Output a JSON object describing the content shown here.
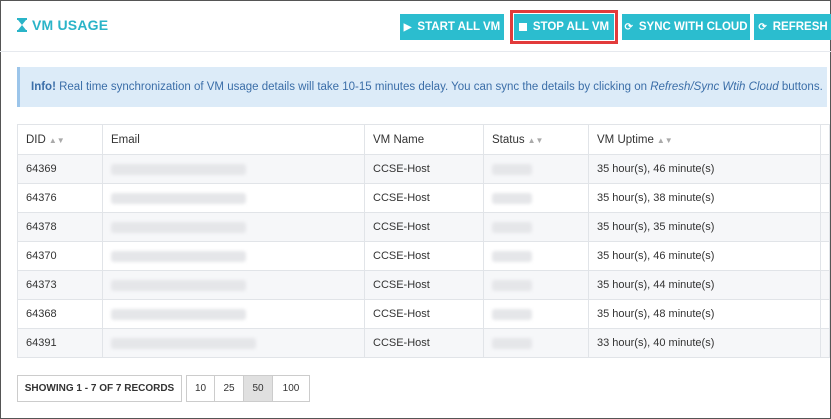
{
  "header": {
    "title": "VM USAGE",
    "title_icon": "hourglass-icon",
    "buttons": {
      "start_all": "START ALL VM",
      "stop_all": "STOP ALL VM",
      "sync_cloud": "SYNC WITH CLOUD",
      "refresh": "REFRESH"
    }
  },
  "info": {
    "label": "Info!",
    "text": " Real time synchronization of VM usage details will take 10-15 minutes delay. You can sync the details by clicking on ",
    "emphasis": "Refresh/Sync Wtih Cloud",
    "suffix": " buttons."
  },
  "table": {
    "columns": [
      "DID",
      "Email",
      "VM Name",
      "Status",
      "VM Uptime"
    ],
    "rows": [
      {
        "did": "64369",
        "vm_name": "CCSE-Host",
        "uptime": "35 hour(s), 46 minute(s)"
      },
      {
        "did": "64376",
        "vm_name": "CCSE-Host",
        "uptime": "35 hour(s), 38 minute(s)"
      },
      {
        "did": "64378",
        "vm_name": "CCSE-Host",
        "uptime": "35 hour(s), 35 minute(s)"
      },
      {
        "did": "64370",
        "vm_name": "CCSE-Host",
        "uptime": "35 hour(s), 46 minute(s)"
      },
      {
        "did": "64373",
        "vm_name": "CCSE-Host",
        "uptime": "35 hour(s), 44 minute(s)"
      },
      {
        "did": "64368",
        "vm_name": "CCSE-Host",
        "uptime": "35 hour(s), 48 minute(s)"
      },
      {
        "did": "64391",
        "vm_name": "CCSE-Host",
        "uptime": "33 hour(s), 40 minute(s)"
      }
    ]
  },
  "pager": {
    "summary": "SHOWING 1 - 7 OF 7 RECORDS",
    "sizes": [
      "10",
      "25",
      "50",
      "100"
    ],
    "active": "50"
  },
  "colors": {
    "accent": "#2bbdcf",
    "highlight": "#e23b3b",
    "info_bg": "#dcebf8"
  }
}
